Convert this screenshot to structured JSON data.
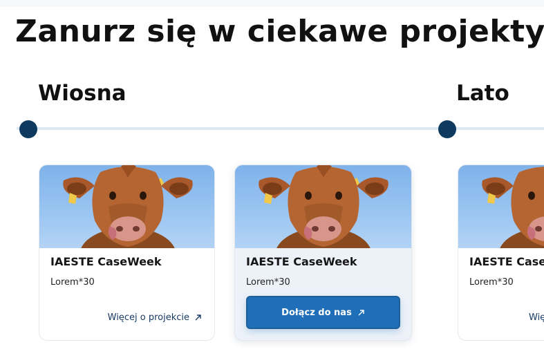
{
  "page": {
    "title": "Zanurz się w ciekawe projekty!"
  },
  "timeline": {
    "seasons": [
      {
        "label": "Wiosna"
      },
      {
        "label": "Lato"
      }
    ]
  },
  "cards": [
    {
      "title": "IAESTE CaseWeek",
      "description": "Lorem*30",
      "link_label": "Więcej o projekcie",
      "image_subject": "cow",
      "link_icon": "arrow-up-right-icon"
    },
    {
      "title": "IAESTE CaseWeek",
      "description": "Lorem*30",
      "button_label": "Dołącz do nas",
      "image_subject": "cow",
      "button_icon": "arrow-up-right-icon",
      "state": "active"
    },
    {
      "title": "IAESTE CaseWeek",
      "description": "Lorem*30",
      "link_label": "Więcej o projekcie",
      "image_subject": "cow",
      "link_icon": "arrow-up-right-icon"
    }
  ],
  "colors": {
    "accent": "#1f6fb8",
    "timeline_dot": "#0d3a5e",
    "timeline_line": "#dce8f3",
    "link": "#173a63",
    "sky": "#8fbfef"
  }
}
